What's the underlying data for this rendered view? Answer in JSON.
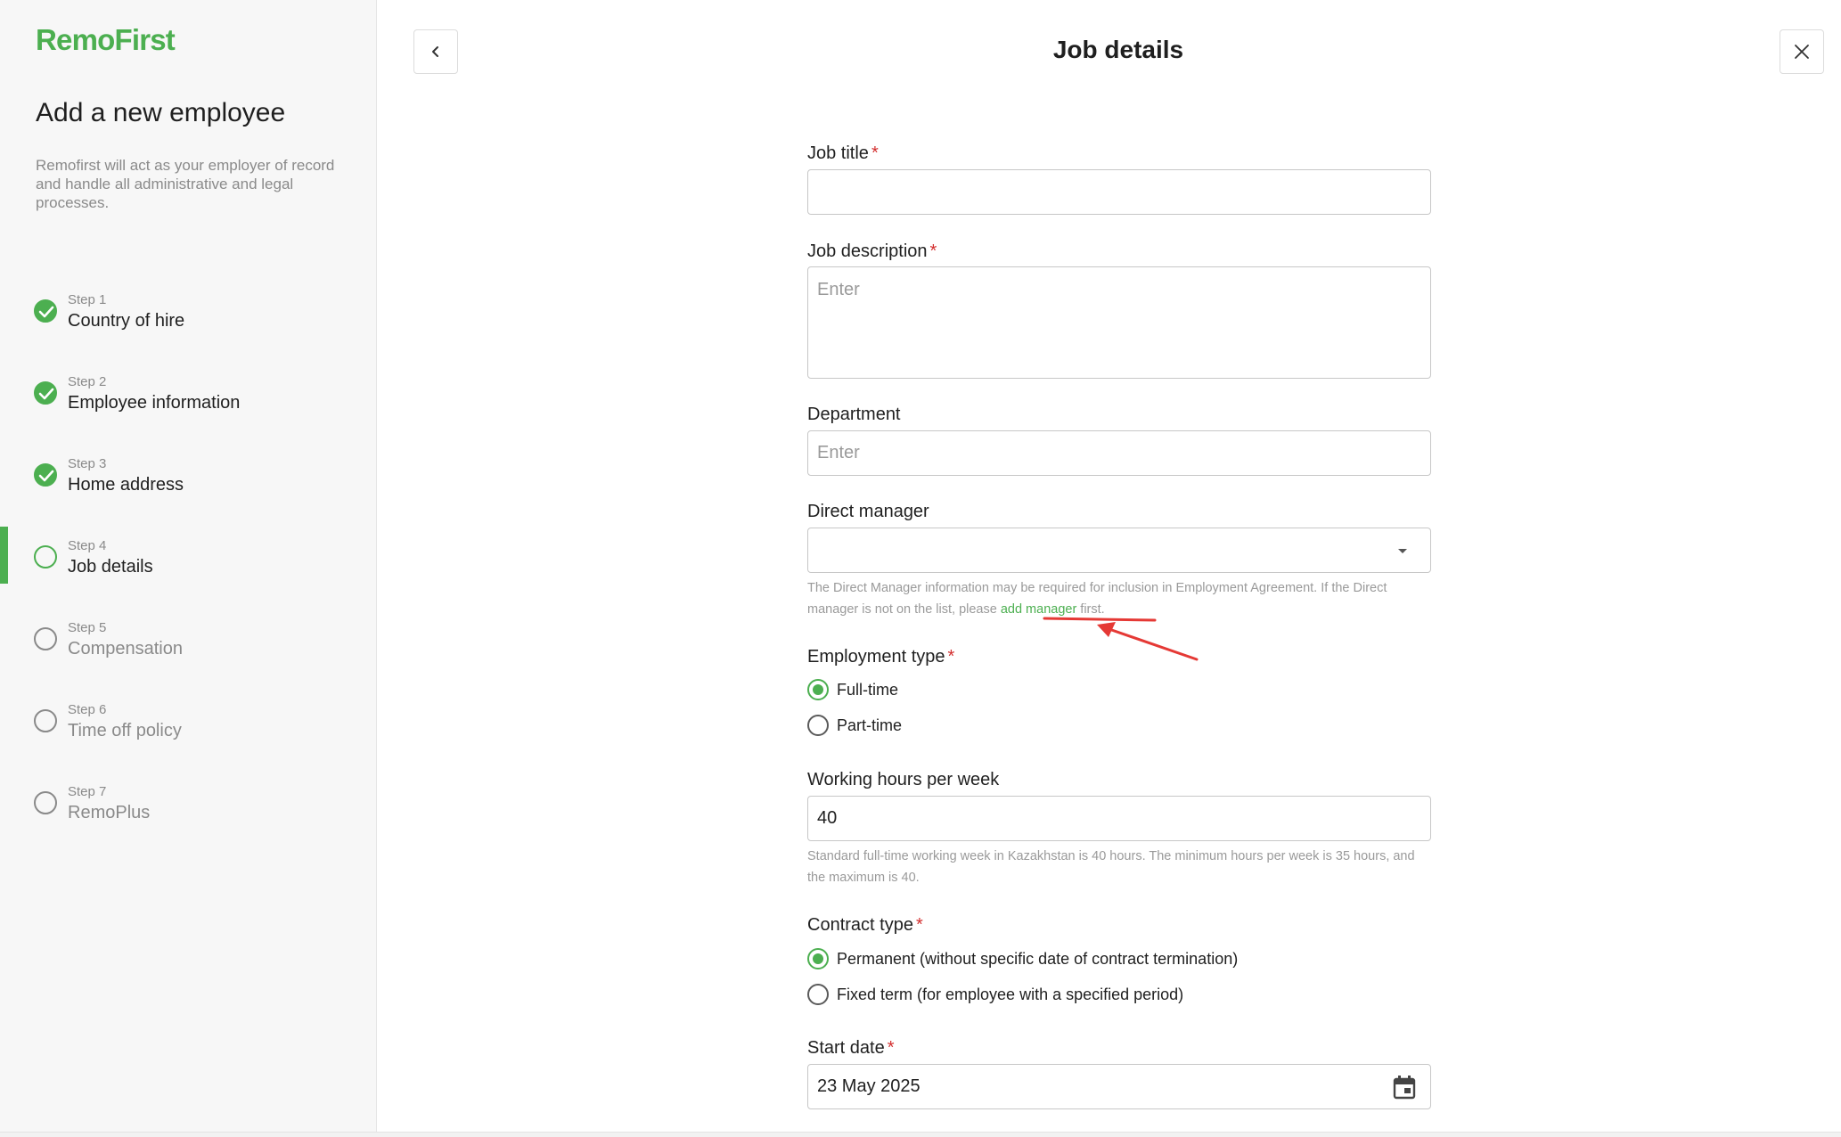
{
  "brand": {
    "logo": "RemoFirst",
    "accent": "#4caf50"
  },
  "sidebar": {
    "title": "Add a new employee",
    "description": "Remofirst will act as your employer of record and handle all administrative and legal processes.",
    "steps": [
      {
        "num": "Step 1",
        "label": "Country of hire",
        "status": "done"
      },
      {
        "num": "Step 2",
        "label": "Employee information",
        "status": "done"
      },
      {
        "num": "Step 3",
        "label": "Home address",
        "status": "done"
      },
      {
        "num": "Step 4",
        "label": "Job details",
        "status": "current"
      },
      {
        "num": "Step 5",
        "label": "Compensation",
        "status": "pending"
      },
      {
        "num": "Step 6",
        "label": "Time off policy",
        "status": "pending"
      },
      {
        "num": "Step 7",
        "label": "RemoPlus",
        "status": "pending"
      }
    ]
  },
  "header": {
    "title": "Job details",
    "back_icon": "chevron-left-icon",
    "close_icon": "close-icon"
  },
  "form": {
    "job_title": {
      "label": "Job title",
      "required": "*",
      "value": ""
    },
    "job_description": {
      "label": "Job description",
      "required": "*",
      "placeholder": "Enter"
    },
    "department": {
      "label": "Department",
      "placeholder": "Enter"
    },
    "direct_manager": {
      "label": "Direct manager",
      "value": "",
      "hint_before": "The Direct Manager information may be required for inclusion in Employment Agreement. If the Direct manager is not on the list, please ",
      "hint_link": "add manager",
      "hint_after": " first."
    },
    "employment_type": {
      "label": "Employment type",
      "required": "*",
      "options": [
        {
          "label": "Full-time",
          "checked": true
        },
        {
          "label": "Part-time",
          "checked": false
        }
      ]
    },
    "working_hours": {
      "label": "Working hours per week",
      "value": "40",
      "hint": "Standard full-time working week in Kazakhstan is 40 hours. The minimum hours per week is 35 hours, and the maximum is 40."
    },
    "contract_type": {
      "label": "Contract type",
      "required": "*",
      "options": [
        {
          "label": "Permanent (without specific date of contract termination)",
          "checked": true
        },
        {
          "label": "Fixed term (for employee with a specified period)",
          "checked": false
        }
      ]
    },
    "start_date": {
      "label": "Start date",
      "required": "*",
      "value": "23 May 2025",
      "icon": "calendar-icon"
    }
  },
  "annotation": {
    "color": "#e53935",
    "target": "add manager"
  }
}
